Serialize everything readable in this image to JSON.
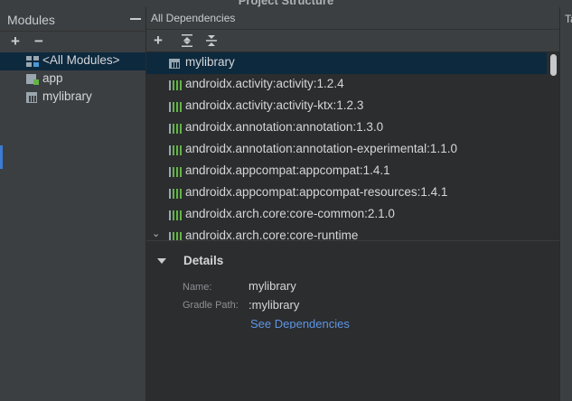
{
  "window": {
    "title": "Project Structure"
  },
  "modules": {
    "header": "Modules",
    "items": [
      {
        "label": "<All Modules>",
        "icon": "all-modules-icon",
        "selected": true
      },
      {
        "label": "app",
        "icon": "app-module-icon",
        "selected": false
      },
      {
        "label": "mylibrary",
        "icon": "library-module-icon",
        "selected": false
      }
    ]
  },
  "dependencies": {
    "header": "All Dependencies",
    "rows": [
      {
        "label": "mylibrary",
        "icon": "module-icon",
        "selected": true
      },
      {
        "label": "androidx.activity:activity:1.2.4",
        "icon": "library-icon"
      },
      {
        "label": "androidx.activity:activity-ktx:1.2.3",
        "icon": "library-icon"
      },
      {
        "label": "androidx.annotation:annotation:1.3.0",
        "icon": "library-icon"
      },
      {
        "label": "androidx.annotation:annotation-experimental:1.1.0",
        "icon": "library-icon"
      },
      {
        "label": "androidx.appcompat:appcompat:1.4.1",
        "icon": "library-icon"
      },
      {
        "label": "androidx.appcompat:appcompat-resources:1.4.1",
        "icon": "library-icon"
      },
      {
        "label": "androidx.arch.core:core-common:2.1.0",
        "icon": "library-icon"
      },
      {
        "label": "androidx.arch.core:core-runtime",
        "icon": "library-icon",
        "expandable": true
      }
    ]
  },
  "details": {
    "title": "Details",
    "name_label": "Name:",
    "name_value": "mylibrary",
    "gradle_label": "Gradle Path:",
    "gradle_value": ":mylibrary",
    "link": "See Dependencies"
  },
  "right_tab": {
    "label": "Ta"
  },
  "colors": {
    "accent": "#3d7cd4",
    "selection": "#0d293e",
    "link": "#5e95e4",
    "library_icon": "#62b543"
  }
}
